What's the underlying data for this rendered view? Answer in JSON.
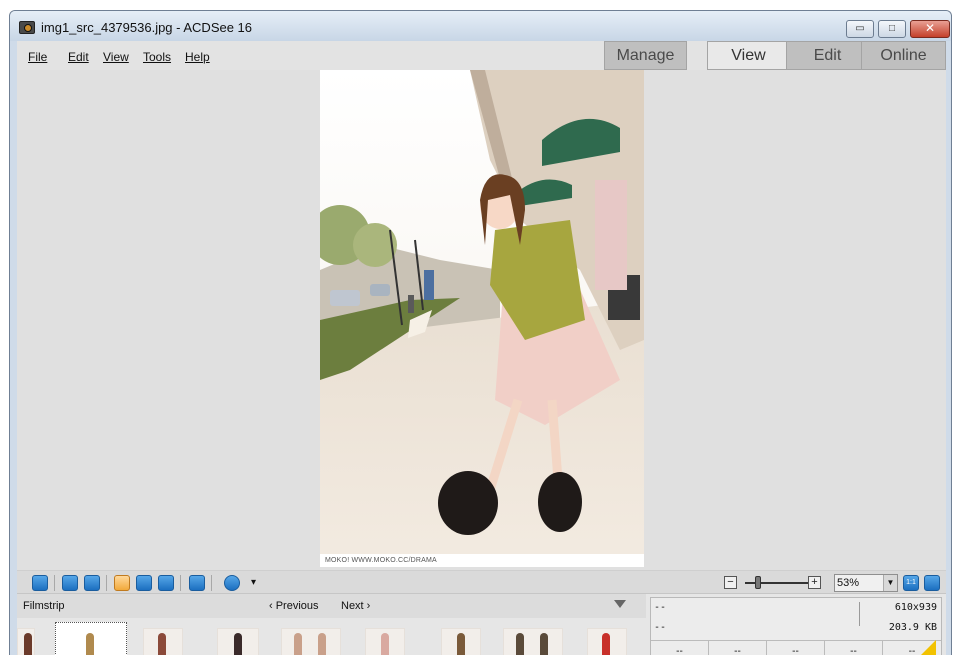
{
  "window": {
    "title": "img1_src_4379536.jpg - ACDSee 16",
    "minimize_glyph": "▭",
    "maximize_glyph": "□",
    "close_glyph": "✕"
  },
  "menu": {
    "items": [
      "File",
      "Edit",
      "View",
      "Tools",
      "Help"
    ]
  },
  "modes": [
    {
      "label": "Manage",
      "active": false
    },
    {
      "label": "View",
      "active": true
    },
    {
      "label": "Edit",
      "active": false
    },
    {
      "label": "Online",
      "active": false
    }
  ],
  "viewer": {
    "caption": "MOKO! WWW.MOKO.CC/DRAMA"
  },
  "toolbar": {
    "zoom_minus": "−",
    "zoom_plus": "+",
    "zoom_value": "53%",
    "zoom_level": 0.2,
    "dropdown_glyph": "▼",
    "more_glyph": "▾",
    "actual_size_glyph": "1:1"
  },
  "filmstrip": {
    "title": "Filmstrip",
    "previous": "‹ Previous",
    "next": "Next ›"
  },
  "info": {
    "row1_left": "--",
    "dimensions": "610x939",
    "row2_left": "--",
    "filesize": "203.9 KB",
    "cells": [
      "--",
      "--",
      "--",
      "--",
      "--"
    ]
  },
  "colors": {
    "title_gradient_top": "#e6eef7",
    "active_tool": "#f2a93b",
    "tool_blue": "#1c6fc0",
    "close_red": "#c4402a"
  }
}
